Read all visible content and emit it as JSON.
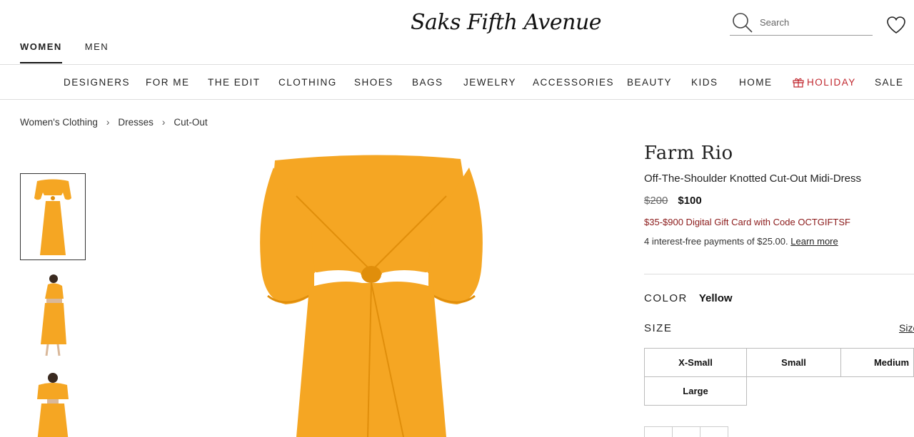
{
  "header": {
    "logo": "Saks Fifth Avenue",
    "gender_tabs": [
      "WOMEN",
      "MEN"
    ],
    "search_placeholder": "Search"
  },
  "category_nav": [
    "DESIGNERS",
    "FOR ME",
    "THE EDIT",
    "CLOTHING",
    "SHOES",
    "BAGS",
    "JEWELRY",
    "ACCESSORIES",
    "BEAUTY",
    "KIDS",
    "HOME",
    "HOLIDAY",
    "SALE"
  ],
  "breadcrumb": [
    "Women's Clothing",
    "Dresses",
    "Cut-Out"
  ],
  "product": {
    "brand": "Farm Rio",
    "name": "Off-The-Shoulder Knotted Cut-Out Midi-Dress",
    "price_original": "$200",
    "price_sale": "$100",
    "promo": "$35-$900 Digital Gift Card with Code OCTGIFTSF",
    "installments_text": "4 interest-free payments of $25.00.",
    "learn_more": "Learn more",
    "color_label": "COLOR",
    "color_value": "Yellow",
    "size_label": "SIZE",
    "size_guide": "Size",
    "sizes": [
      "X-Small",
      "Small",
      "Medium",
      "Large"
    ]
  },
  "colors": {
    "dress": "#F5A623",
    "dress_shadow": "#E08E0B",
    "holiday": "#c0262d",
    "promo": "#8b1a1a"
  }
}
